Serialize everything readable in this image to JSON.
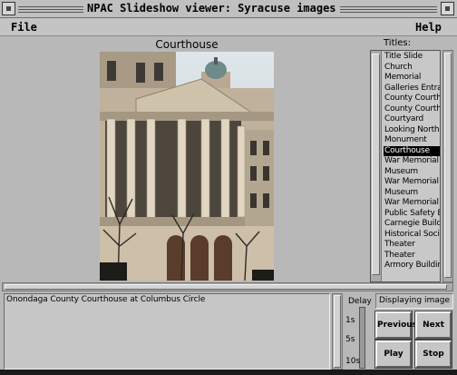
{
  "window": {
    "title": "NPAC Slideshow viewer: Syracuse images"
  },
  "menu": {
    "file": "File",
    "help": "Help"
  },
  "image": {
    "caption": "Courthouse"
  },
  "titles": {
    "label": "Titles:",
    "items": [
      "Title Slide",
      "Church",
      "Memorial",
      "Galleries Entrance",
      "County Courthouse",
      "County Courthouse",
      "Courtyard",
      "Looking North",
      "Monument",
      "Courthouse",
      "War Memorial",
      "Museum",
      "War Memorial",
      "Museum",
      "War Memorial",
      "Public Safety Building",
      "Carnegie Building",
      "Historical Society",
      "Theater",
      "Theater",
      "Armory Building"
    ],
    "selected_index": 9
  },
  "description": {
    "text": "Onondaga County Courthouse at Columbus Circle"
  },
  "delay": {
    "label": "Delay",
    "ticks": [
      "1s",
      "5s",
      "10s"
    ]
  },
  "status": {
    "text": "Displaying image"
  },
  "buttons": {
    "previous": "Previous",
    "next": "Next",
    "play": "Play",
    "stop": "Stop"
  },
  "colors": {
    "selection_bg": "#000000",
    "selection_fg": "#ffffff",
    "window_bg": "#b8b8b8"
  }
}
